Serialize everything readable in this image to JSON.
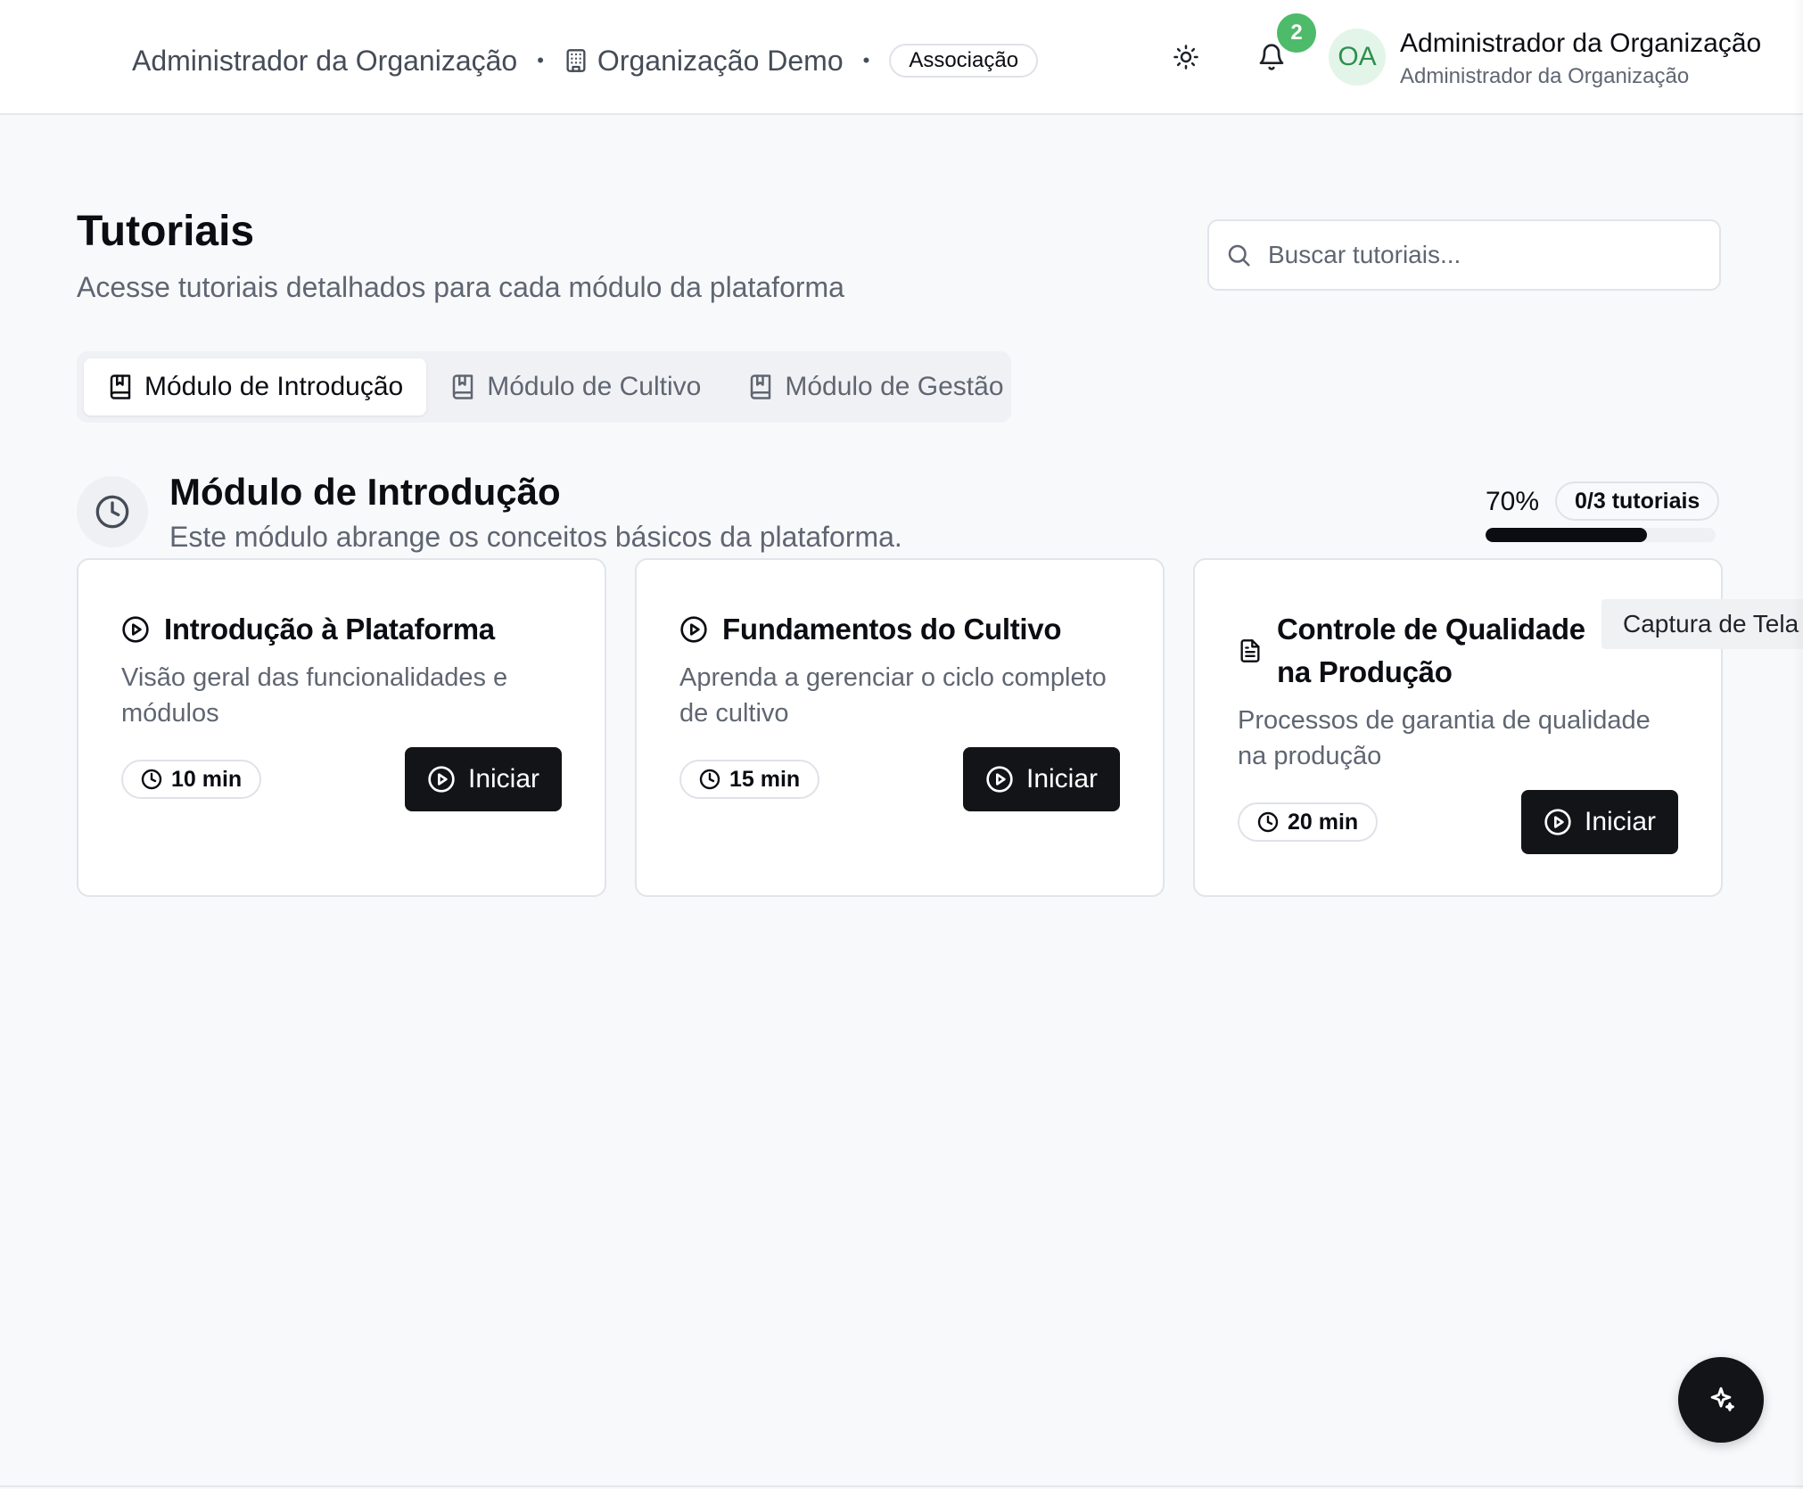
{
  "header": {
    "breadcrumb_role": "Administrador da Organização",
    "organization": "Organização Demo",
    "association_badge": "Associação",
    "notification_count": "2",
    "avatar_initials": "OA",
    "user_name": "Administrador da Organização",
    "user_role": "Administrador da Organização",
    "icons": {
      "theme": "sun-icon",
      "notifications": "bell-icon",
      "organization": "building-icon"
    }
  },
  "page": {
    "title": "Tutoriais",
    "subtitle": "Acesse tutoriais detalhados para cada módulo da plataforma",
    "search_placeholder": "Buscar tutoriais..."
  },
  "tabs": [
    {
      "label": "Módulo de Introdução",
      "active": true,
      "icon": "book-icon"
    },
    {
      "label": "Módulo de Cultivo",
      "active": false,
      "icon": "book-icon"
    },
    {
      "label": "Módulo de Gestão",
      "active": false,
      "icon": "book-icon"
    }
  ],
  "module": {
    "title": "Módulo de Introdução",
    "description": "Este módulo abrange os conceitos básicos da plataforma.",
    "progress_label": "70%",
    "progress_value": 0.7,
    "tutorial_count": "0/3 tutoriais",
    "icon": "clock-icon"
  },
  "cards": [
    {
      "title": "Introdução à Plataforma",
      "description": "Visão geral das funcionalidades e módulos",
      "duration": "10 min",
      "button": "Iniciar",
      "icon": "play-circle-icon"
    },
    {
      "title": "Fundamentos do Cultivo",
      "description": "Aprenda a gerenciar o ciclo completo de cultivo",
      "duration": "15 min",
      "button": "Iniciar",
      "icon": "play-circle-icon"
    },
    {
      "title": "Controle de Qualidade na Produção",
      "description": "Processos de garantia de qualidade na produção",
      "duration": "20 min",
      "button": "Iniciar",
      "icon": "document-icon"
    }
  ],
  "tooltip": "Captura de Tela",
  "fab_icon": "sparkles-icon",
  "colors": {
    "accent_dark": "#121417",
    "badge_green": "#4dbb6a",
    "muted_text": "#5f6672"
  }
}
